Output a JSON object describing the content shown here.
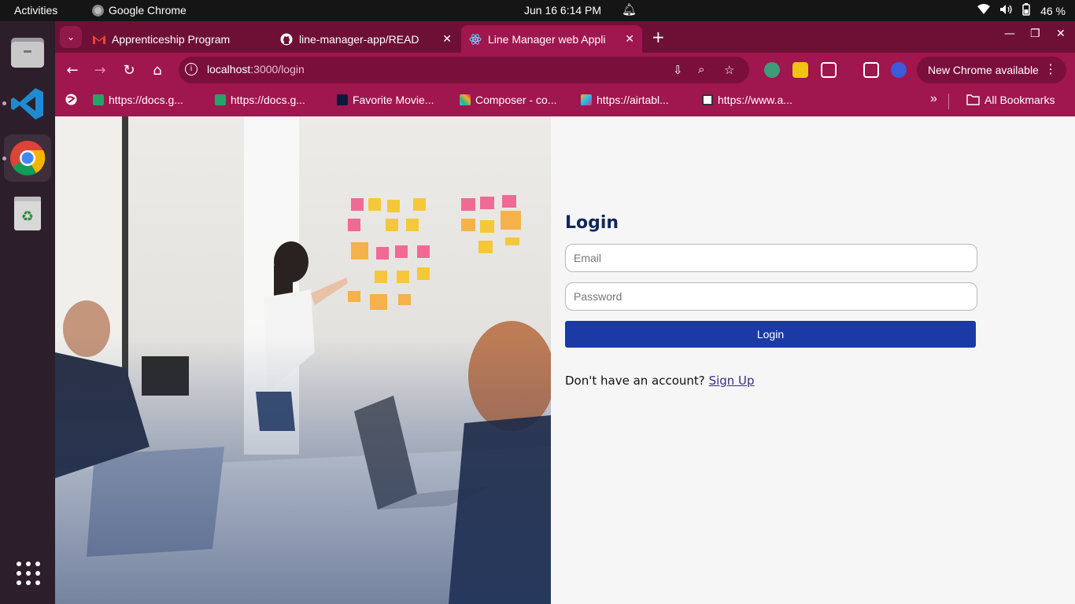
{
  "system": {
    "activities": "Activities",
    "app_name": "Google Chrome",
    "clock": "Jun 16  6:14 PM",
    "battery": "46 %"
  },
  "browser": {
    "tabs": [
      {
        "title": "Apprenticeship Program",
        "favicon": "gmail-icon"
      },
      {
        "title": "line-manager-app/READ",
        "favicon": "github-icon"
      },
      {
        "title": "Line Manager web Appli",
        "favicon": "react-icon",
        "active": true
      }
    ],
    "url_host": "localhost",
    "url_path": ":3000/login",
    "new_chrome": "New Chrome available",
    "bookmarks": [
      {
        "label": "https://docs.g...",
        "icon": "sheets-icon"
      },
      {
        "label": "https://docs.g...",
        "icon": "sheets-icon"
      },
      {
        "label": "Favorite Movie...",
        "icon": "prime-icon"
      },
      {
        "label": "Composer - co...",
        "icon": "slack-icon"
      },
      {
        "label": "https://airtabl...",
        "icon": "airtable-icon"
      },
      {
        "label": "https://www.a...",
        "icon": "site-icon"
      }
    ],
    "all_bookmarks": "All Bookmarks"
  },
  "login": {
    "title": "Login",
    "email_placeholder": "Email",
    "password_placeholder": "Password",
    "button": "Login",
    "signup_prompt": "Don't have an account?",
    "signup_link": "Sign Up"
  },
  "colors": {
    "tabstrip": "#6e1036",
    "toolbar": "#a0164e",
    "button": "#1b3aa6",
    "heading": "#12285a"
  }
}
